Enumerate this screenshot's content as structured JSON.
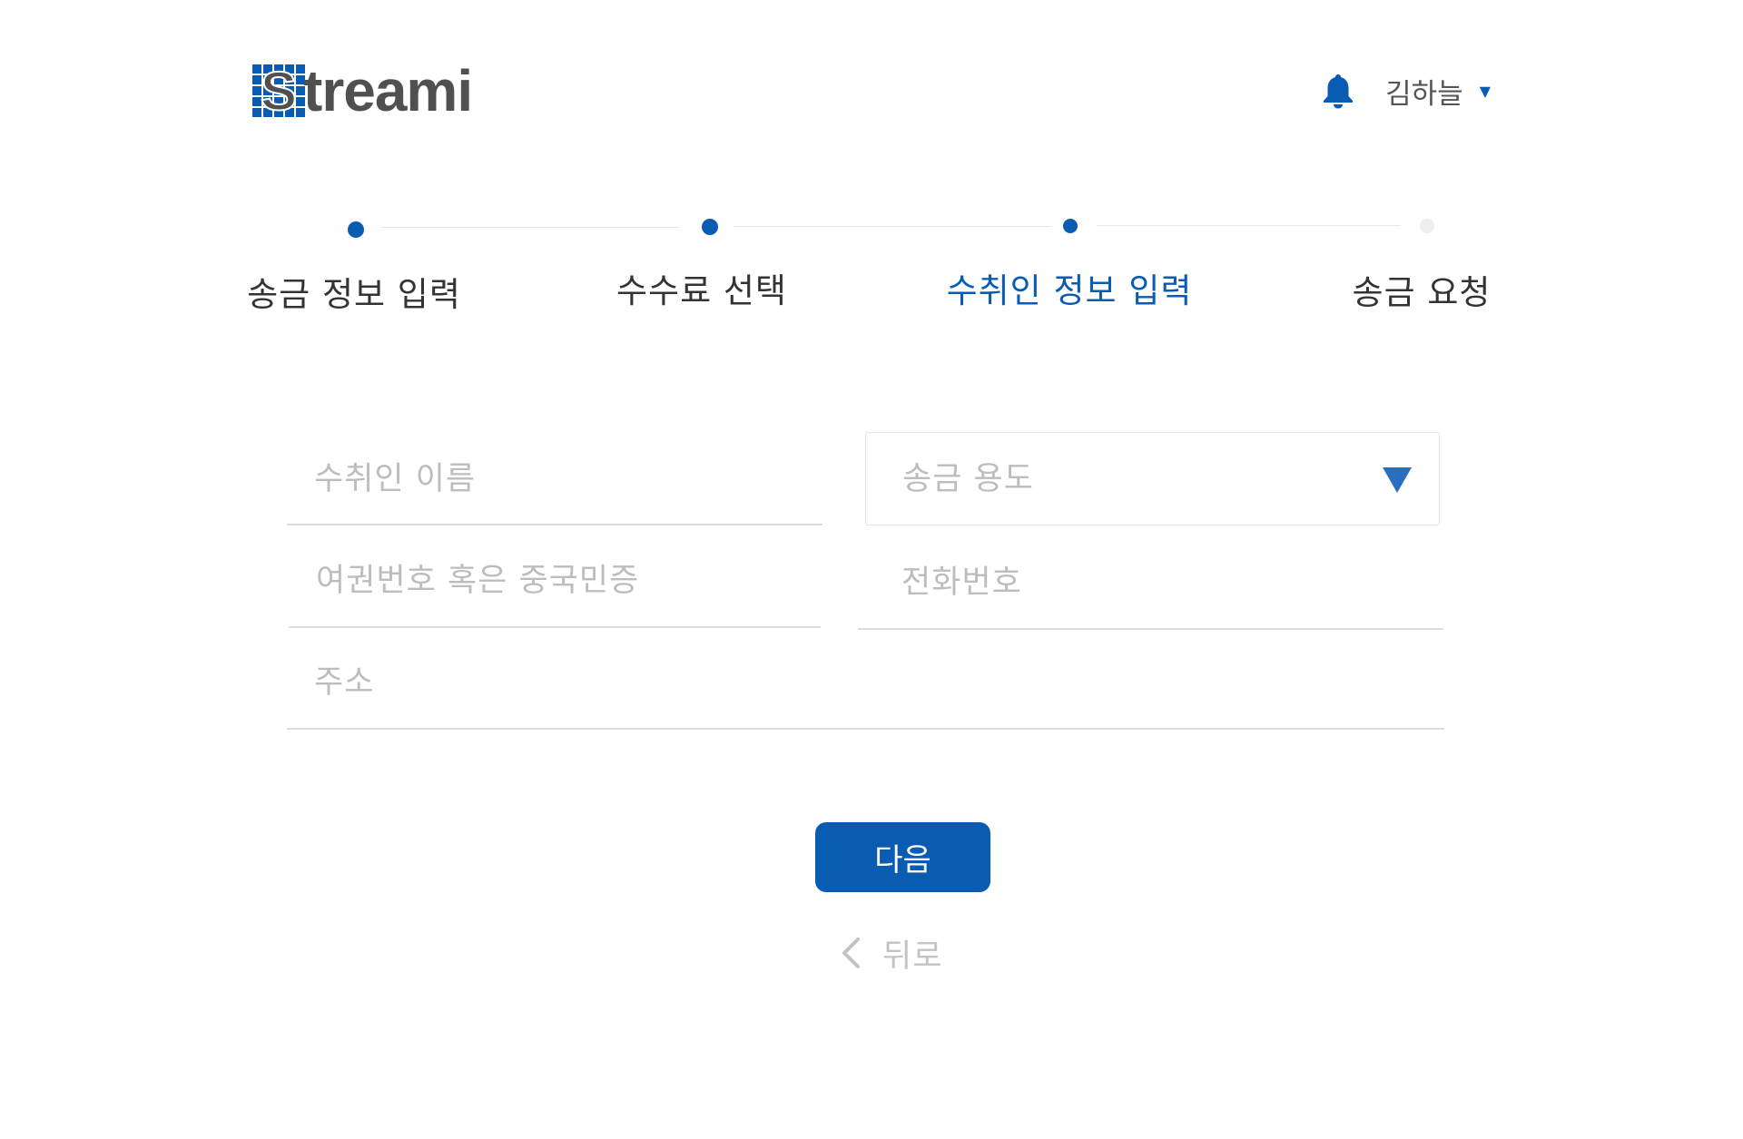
{
  "header": {
    "logo_text": "treami",
    "logo_initial": "S",
    "user_name": "김하늘",
    "user_caret": "▼"
  },
  "stepper": {
    "steps": [
      {
        "label": "송금 정보 입력",
        "state": "done"
      },
      {
        "label": "수수료 선택",
        "state": "done"
      },
      {
        "label": "수취인 정보 입력",
        "state": "active"
      },
      {
        "label": "송금 요청",
        "state": "pending"
      }
    ]
  },
  "form": {
    "recipient_name": {
      "placeholder": "수취인 이름",
      "value": ""
    },
    "purpose": {
      "placeholder": "송금 용도"
    },
    "passport": {
      "placeholder": "여권번호 혹은 중국민증",
      "value": ""
    },
    "phone": {
      "placeholder": "전화번호",
      "value": ""
    },
    "address": {
      "placeholder": "주소",
      "value": ""
    }
  },
  "actions": {
    "next_label": "다음",
    "back_label": "뒤로"
  },
  "colors": {
    "brand": "#0a5cb3",
    "pending_dot": "#eeeeee",
    "placeholder": "#bdbdbd"
  }
}
